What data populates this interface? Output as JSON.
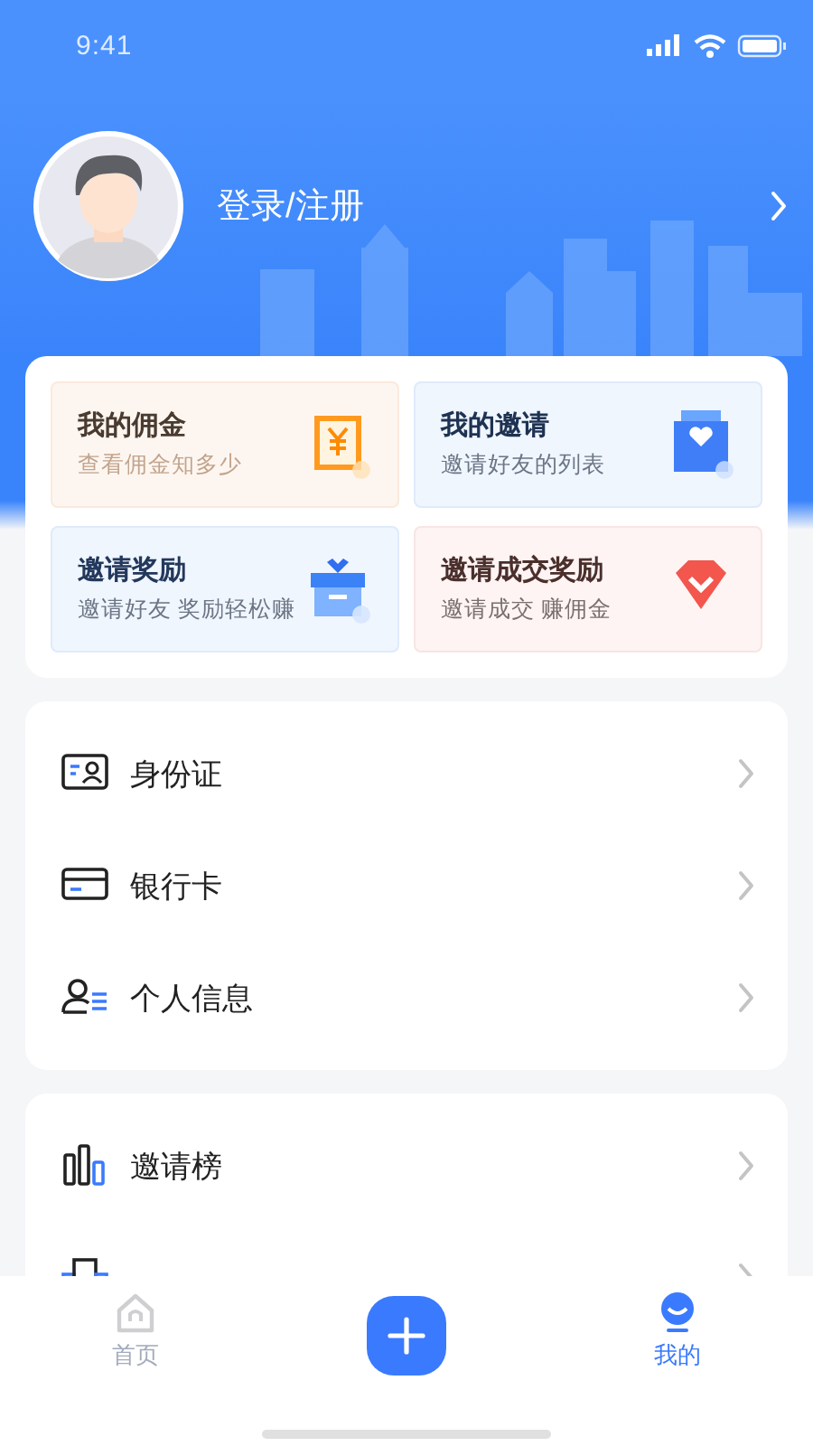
{
  "status_bar": {
    "time": "9:41"
  },
  "profile": {
    "login_label": "登录/注册"
  },
  "shortcuts": [
    {
      "kind": "commission",
      "title": "我的佣金",
      "subtitle": "查看佣金知多少"
    },
    {
      "kind": "invites",
      "title": "我的邀请",
      "subtitle": "邀请好友的列表"
    },
    {
      "kind": "reward",
      "title": "邀请奖励",
      "subtitle": "邀请好友 奖励轻松赚"
    },
    {
      "kind": "deal",
      "title": "邀请成交奖励",
      "subtitle": "邀请成交 赚佣金"
    }
  ],
  "menu_groups": [
    {
      "items": [
        {
          "kind": "id_card",
          "label": "身份证"
        },
        {
          "kind": "bank_card",
          "label": "银行卡"
        },
        {
          "kind": "person",
          "label": "个人信息"
        }
      ]
    },
    {
      "items": [
        {
          "kind": "invite_rank",
          "label": "邀请榜"
        },
        {
          "kind": "deal_rank"
        }
      ]
    }
  ],
  "tab_bar": {
    "tabs": [
      {
        "kind": "home",
        "label": "首页",
        "selected": false
      },
      {
        "kind": "mine",
        "label": "我的",
        "selected": true
      }
    ]
  }
}
